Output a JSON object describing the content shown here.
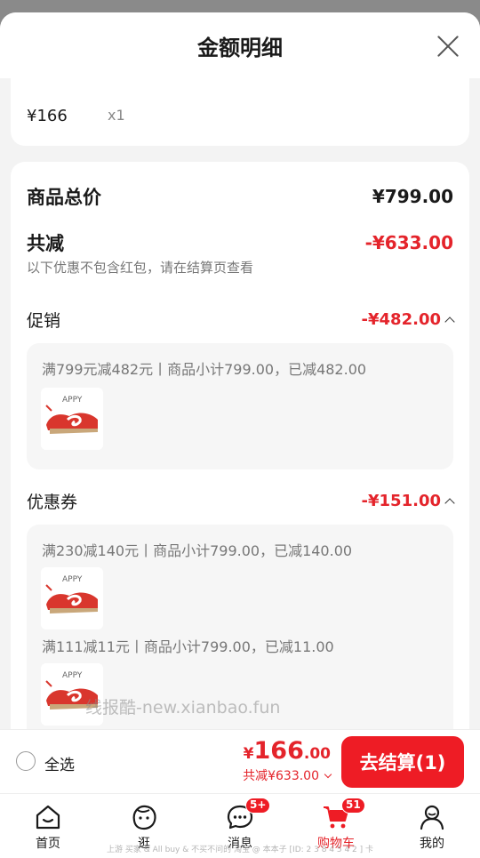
{
  "sheet": {
    "title": "金额明细"
  },
  "top_item": {
    "price": "¥166",
    "qty": "x1"
  },
  "summary": {
    "total_label": "商品总价",
    "total_value": "¥799.00",
    "discount_label": "共减",
    "discount_value": "-¥633.00",
    "note": "以下优惠不包含红包，请在结算页查看"
  },
  "promotion": {
    "label": "促销",
    "amount": "-¥482.00",
    "lines": [
      "满799元减482元丨商品小计799.00，已减482.00"
    ]
  },
  "coupon": {
    "label": "优惠券",
    "amount": "-¥151.00",
    "lines": [
      "满230减140元丨商品小计799.00，已减140.00",
      "满111减11元丨商品小计799.00，已减11.00"
    ]
  },
  "watermark": "线报酷-new.xianbao.fun",
  "footer": {
    "select_all": "全选",
    "currency": "¥",
    "price_int": "166",
    "price_dec": ".00",
    "saved": "共减¥633.00",
    "checkout": "去结算(1)"
  },
  "tabs": [
    {
      "label": "首页",
      "icon": "home-icon"
    },
    {
      "label": "逛",
      "icon": "face-icon"
    },
    {
      "label": "消息",
      "icon": "message-icon",
      "badge": "5+"
    },
    {
      "label": "购物车",
      "icon": "cart-icon",
      "badge": "51"
    },
    {
      "label": "我的",
      "icon": "profile-icon"
    }
  ],
  "caption": "上游 买家 & All buy & 不买不问的 淘宝 @ 本本子 [ID: 2 3 8 4 5 4 2 ] 卡",
  "colors": {
    "accent": "#ee1c25",
    "price_red": "#e4242b",
    "text": "#1a1a1a",
    "muted": "#777777"
  }
}
